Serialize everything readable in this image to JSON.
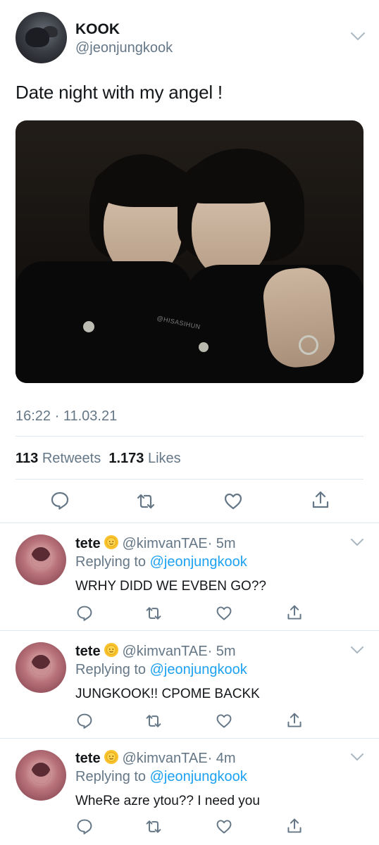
{
  "tweet": {
    "author_name": "KOOK",
    "author_handle": "@jeonjungkook",
    "text": "Date night with my angel !",
    "photo_watermark": "@HISASIHUN",
    "timestamp": "16:22 · 11.03.21",
    "retweets_count": "113",
    "retweets_label": "Retweets",
    "likes_count": "1.173",
    "likes_label": "Likes"
  },
  "replies": [
    {
      "name": "tete",
      "handle": "@kimvanTAE",
      "time": "· 5m",
      "replying_prefix": "Replying to",
      "replying_to": "@jeonjungkook",
      "text": "WRHY DIDD WE EVBEN GO??"
    },
    {
      "name": "tete",
      "handle": "@kimvanTAE",
      "time": "· 5m",
      "replying_prefix": "Replying to",
      "replying_to": "@jeonjungkook",
      "text": "JUNGKOOK!! CPOME BACKK"
    },
    {
      "name": "tete",
      "handle": "@kimvanTAE",
      "time": "· 4m",
      "replying_prefix": "Replying to",
      "replying_to": "@jeonjungkook",
      "text": "WheRe azre ytou?? I need you"
    }
  ],
  "icons": {
    "reply": "reply-icon",
    "retweet": "retweet-icon",
    "like": "heart-icon",
    "share": "share-icon",
    "more": "chevron-down-icon",
    "emoji": "sun-emoji-icon"
  },
  "colors": {
    "text": "#14171a",
    "secondary": "#657786",
    "link": "#1da1f2",
    "divider": "#e1e8ed",
    "icon": "#657786"
  }
}
